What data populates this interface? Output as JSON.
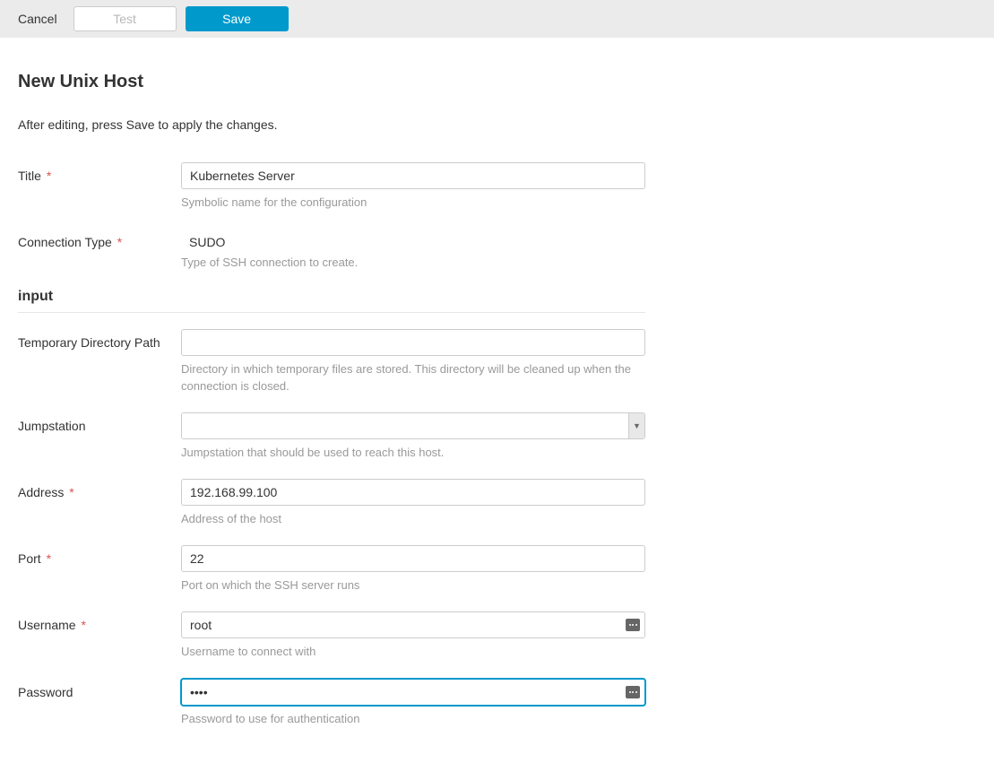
{
  "topbar": {
    "cancel": "Cancel",
    "test": "Test",
    "save": "Save"
  },
  "page": {
    "title": "New Unix Host",
    "intro": "After editing, press Save to apply the changes."
  },
  "fields": {
    "title": {
      "label": "Title",
      "value": "Kubernetes Server",
      "help": "Symbolic name for the configuration"
    },
    "connectionType": {
      "label": "Connection Type",
      "value": "SUDO",
      "help": "Type of SSH connection to create."
    },
    "section_input": "input",
    "tmpDir": {
      "label": "Temporary Directory Path",
      "value": "",
      "help": "Directory in which temporary files are stored. This directory will be cleaned up when the connection is closed."
    },
    "jumpstation": {
      "label": "Jumpstation",
      "value": "",
      "help": "Jumpstation that should be used to reach this host."
    },
    "address": {
      "label": "Address",
      "value": "192.168.99.100",
      "help": "Address of the host"
    },
    "port": {
      "label": "Port",
      "value": "22",
      "help": "Port on which the SSH server runs"
    },
    "username": {
      "label": "Username",
      "value": "root",
      "help": "Username to connect with"
    },
    "password": {
      "label": "Password",
      "value": "••••",
      "help": "Password to use for authentication"
    }
  }
}
